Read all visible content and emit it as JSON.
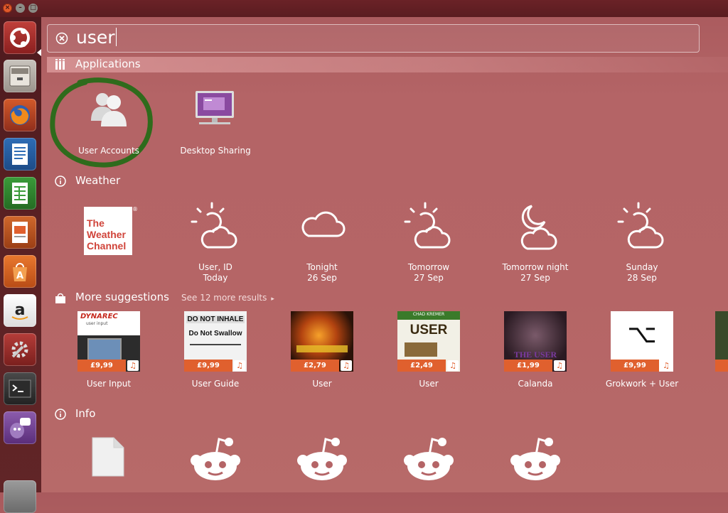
{
  "window": {
    "close_glyph": "×",
    "min_glyph": "–",
    "max_glyph": "□"
  },
  "launcher": {
    "items": [
      {
        "name": "ubuntu-dash-icon"
      },
      {
        "name": "files-icon"
      },
      {
        "name": "firefox-icon"
      },
      {
        "name": "writer-icon"
      },
      {
        "name": "calc-icon"
      },
      {
        "name": "impress-icon"
      },
      {
        "name": "software-center-icon"
      },
      {
        "name": "amazon-icon"
      },
      {
        "name": "system-settings-icon"
      },
      {
        "name": "terminal-icon"
      },
      {
        "name": "pidgin-icon"
      },
      {
        "name": "trash-icon"
      }
    ]
  },
  "search": {
    "query": "user"
  },
  "applications": {
    "header": "Applications",
    "items": [
      {
        "label": "User Accounts",
        "icon": "users-icon"
      },
      {
        "label": "Desktop Sharing",
        "icon": "desktop-sharing-icon"
      }
    ]
  },
  "weather": {
    "header": "Weather",
    "provider_lines": [
      "The",
      "Weather",
      "Channel"
    ],
    "provider_mark": "®",
    "items": [
      {
        "line1": "User, ID",
        "line2": "Today",
        "icon": "sun-cloud-icon"
      },
      {
        "line1": "Tonight",
        "line2": "26 Sep",
        "icon": "cloud-icon"
      },
      {
        "line1": "Tomorrow",
        "line2": "27 Sep",
        "icon": "sun-cloud-icon"
      },
      {
        "line1": "Tomorrow night",
        "line2": "27 Sep",
        "icon": "moon-cloud-icon"
      },
      {
        "line1": "Sunday",
        "line2": "28 Sep",
        "icon": "sun-cloud-icon"
      }
    ]
  },
  "suggestions": {
    "header": "More suggestions",
    "more_link": "See 12 more results",
    "more_arrow": "▸",
    "note_glyph": "♫",
    "items": [
      {
        "label": "User Input",
        "price": "£9,99",
        "cover_text": "DYNAREC",
        "cover_sub": "user input"
      },
      {
        "label": "User Guide",
        "price": "£9,99",
        "cover_text": "DO NOT INHALE",
        "cover_sub": "Do Not Swallow"
      },
      {
        "label": "User",
        "price": "£2,79",
        "cover_text": "",
        "cover_sub": ""
      },
      {
        "label": "User",
        "price": "£2,49",
        "cover_text": "USER",
        "cover_sub": "CHAD KREMER"
      },
      {
        "label": "Calanda",
        "price": "£1,99",
        "cover_text": "THE USER",
        "cover_sub": ""
      },
      {
        "label": "Grokwork + User",
        "price": "£9,99",
        "cover_text": "⌥",
        "cover_sub": ""
      }
    ]
  },
  "info": {
    "header": "Info"
  },
  "colors": {
    "accent": "#e0602e",
    "launcher": "#5b2224",
    "highlight": "#2f6b1c"
  }
}
